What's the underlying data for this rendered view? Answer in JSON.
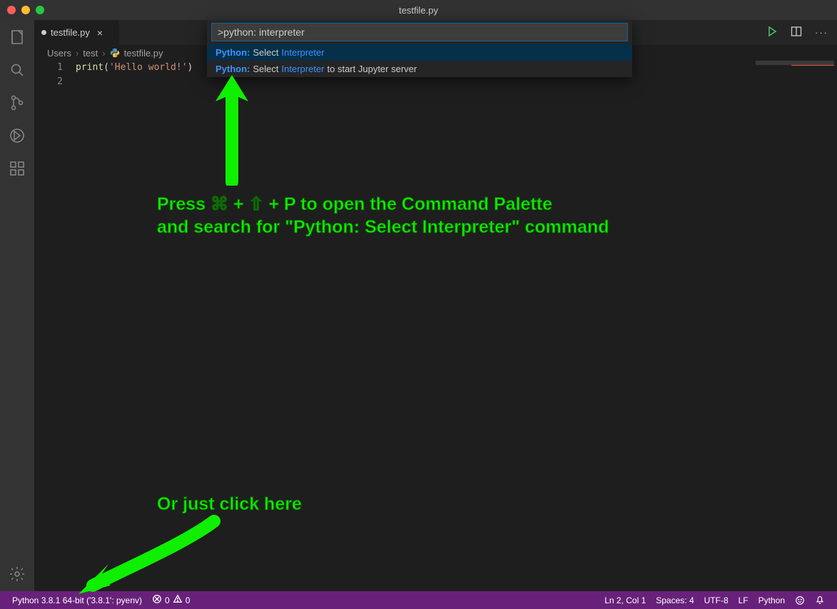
{
  "window": {
    "title": "testfile.py"
  },
  "tab": {
    "filename": "testfile.py"
  },
  "breadcrumb": {
    "seg1": "Users",
    "seg2": "test",
    "seg3": "testfile.py"
  },
  "editor": {
    "line1_num": "1",
    "line2_num": "2",
    "code": {
      "fn": "print",
      "open": "(",
      "str": "'Hello world!'",
      "close": ")"
    }
  },
  "palette": {
    "query": ">python: interpreter",
    "items": [
      {
        "prefix": "Python:",
        "mid": " Select ",
        "match": "Interpreter",
        "suffix": ""
      },
      {
        "prefix": "Python:",
        "mid": " Select ",
        "match": "Interpreter",
        "suffix": " to start Jupyter server"
      }
    ]
  },
  "status": {
    "interpreter": "Python 3.8.1 64-bit ('3.8.1': pyenv)",
    "errors": "0",
    "warnings": "0",
    "cursor": "Ln 2, Col 1",
    "spaces": "Spaces: 4",
    "encoding": "UTF-8",
    "eol": "LF",
    "lang": "Python"
  },
  "annotations": {
    "a1_line1": "Press ⌘ + ⇧ + P to open the Command Palette",
    "a1_line2": "and search for \"Python: Select Interpreter\" command",
    "a2": "Or just click here"
  }
}
